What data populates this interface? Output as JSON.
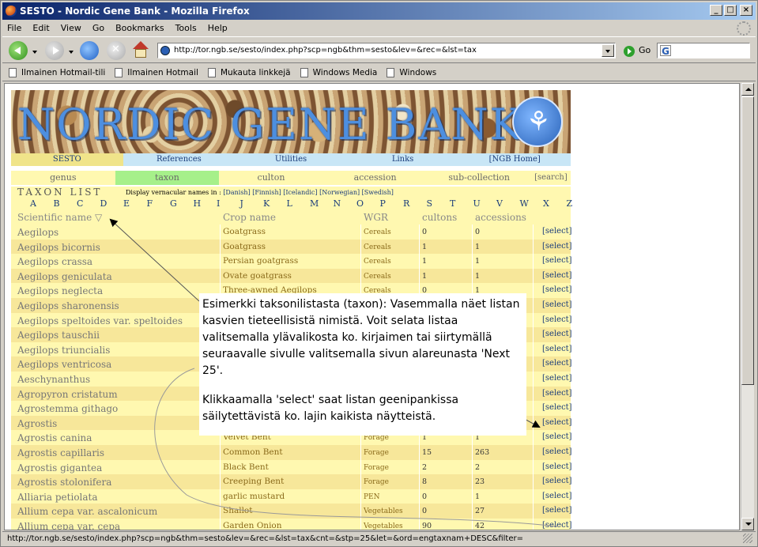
{
  "window": {
    "title": "SESTO - Nordic Gene Bank - Mozilla Firefox",
    "buttons": {
      "minimize": "_",
      "maximize": "□",
      "close": "×"
    }
  },
  "menu": [
    "File",
    "Edit",
    "View",
    "Go",
    "Bookmarks",
    "Tools",
    "Help"
  ],
  "nav": {
    "url": "http://tor.ngb.se/sesto/index.php?scp=ngb&thm=sesto&lev=&rec=&lst=tax",
    "go_label": "Go",
    "search_logo": "G"
  },
  "bookmarks": [
    "Ilmainen Hotmail-tili",
    "Ilmainen Hotmail",
    "Mukauta linkkejä",
    "Windows Media",
    "Windows"
  ],
  "page": {
    "banner_text": "NORDIC GENE BANK",
    "topnav": [
      "SESTO",
      "References",
      "Utilities",
      "Links",
      "[NGB Home]"
    ],
    "subnav": [
      "genus",
      "taxon",
      "culton",
      "accession",
      "sub-collection",
      "[search]"
    ],
    "taxon_list_title": "TAXON LIST",
    "display_label": "Display vernacular names in :",
    "languages": "[Danish] [Finnish] [Icelandic] [Norwegian] [Swedish]",
    "letters": [
      "A",
      "B",
      "C",
      "D",
      "E",
      "F",
      "G",
      "H",
      "I",
      "J",
      "K",
      "L",
      "M",
      "N",
      "O",
      "P",
      "R",
      "S",
      "T",
      "U",
      "V",
      "W",
      "X",
      "Z"
    ],
    "columns": {
      "scientific": "Scientific name ▽",
      "crop": "Crop name",
      "wgr": "WGR",
      "cultons": "cultons",
      "accessions": "accessions"
    },
    "rows": [
      {
        "sci": "Aegilops",
        "crop": "Goatgrass",
        "wgr": "Cereals",
        "cultons": "0",
        "acc": "0",
        "sel": "[select]"
      },
      {
        "sci": "Aegilops bicornis",
        "crop": "Goatgrass",
        "wgr": "Cereals",
        "cultons": "1",
        "acc": "1",
        "sel": "[select]"
      },
      {
        "sci": "Aegilops crassa",
        "crop": "Persian goatgrass",
        "wgr": "Cereals",
        "cultons": "1",
        "acc": "1",
        "sel": "[select]"
      },
      {
        "sci": "Aegilops geniculata",
        "crop": "Ovate goatgrass",
        "wgr": "Cereals",
        "cultons": "1",
        "acc": "1",
        "sel": "[select]"
      },
      {
        "sci": "Aegilops neglecta",
        "crop": "Three-awned Aegilops",
        "wgr": "Cereals",
        "cultons": "0",
        "acc": "1",
        "sel": "[select]"
      },
      {
        "sci": "Aegilops sharonensis",
        "crop": "",
        "wgr": "",
        "cultons": "",
        "acc": "",
        "sel": "[select]"
      },
      {
        "sci": "Aegilops speltoides var. speltoides",
        "crop": "",
        "wgr": "",
        "cultons": "",
        "acc": "",
        "sel": "[select]"
      },
      {
        "sci": "Aegilops tauschii",
        "crop": "",
        "wgr": "",
        "cultons": "",
        "acc": "",
        "sel": "[select]"
      },
      {
        "sci": "Aegilops triuncialis",
        "crop": "",
        "wgr": "",
        "cultons": "",
        "acc": "",
        "sel": "[select]"
      },
      {
        "sci": "Aegilops ventricosa",
        "crop": "",
        "wgr": "",
        "cultons": "",
        "acc": "",
        "sel": "[select]"
      },
      {
        "sci": "Aeschynanthus",
        "crop": "",
        "wgr": "",
        "cultons": "",
        "acc": "",
        "sel": "[select]"
      },
      {
        "sci": "Agropyron cristatum",
        "crop": "",
        "wgr": "",
        "cultons": "",
        "acc": "",
        "sel": "[select]"
      },
      {
        "sci": "Agrostemma githago",
        "crop": "",
        "wgr": "",
        "cultons": "",
        "acc": "",
        "sel": "[select]"
      },
      {
        "sci": "Agrostis",
        "crop": "",
        "wgr": "",
        "cultons": "",
        "acc": "",
        "sel": "[select]"
      },
      {
        "sci": "Agrostis canina",
        "crop": "Velvet Bent",
        "wgr": "Forage",
        "cultons": "1",
        "acc": "1",
        "sel": "[select]"
      },
      {
        "sci": "Agrostis capillaris",
        "crop": "Common Bent",
        "wgr": "Forage",
        "cultons": "15",
        "acc": "263",
        "sel": "[select]"
      },
      {
        "sci": "Agrostis gigantea",
        "crop": "Black Bent",
        "wgr": "Forage",
        "cultons": "2",
        "acc": "2",
        "sel": "[select]"
      },
      {
        "sci": "Agrostis stolonifera",
        "crop": "Creeping Bent",
        "wgr": "Forage",
        "cultons": "8",
        "acc": "23",
        "sel": "[select]"
      },
      {
        "sci": "Alliaria petiolata",
        "crop": "garlic mustard",
        "wgr": "PEN",
        "cultons": "0",
        "acc": "1",
        "sel": "[select]"
      },
      {
        "sci": "Allium cepa var. ascalonicum",
        "crop": "Shallot",
        "wgr": "Vegetables",
        "cultons": "0",
        "acc": "27",
        "sel": "[select]"
      },
      {
        "sci": "Allium cepa var. cepa",
        "crop": "Garden Onion",
        "wgr": "Vegetables",
        "cultons": "90",
        "acc": "42",
        "sel": "[select]"
      }
    ]
  },
  "note": {
    "para1": "Esimerkki taksonilistasta (taxon): Vasemmalla näet listan kasvien tieteellisistä nimistä. Voit selata listaa valitsemalla ylävalikosta ko. kirjaimen tai siirtymällä seuraavalle sivulle valitsemalla sivun alareunasta 'Next 25'.",
    "para2": "Klikkaamalla 'select' saat listan geenipankissa säilytettävistä ko. lajin kaikista näytteistä."
  },
  "status": "http://tor.ngb.se/sesto/index.php?scp=ngb&thm=sesto&lev=&rec=&lst=tax&cnt=&stp=25&let=&ord=engtaxnam+DESC&filter="
}
